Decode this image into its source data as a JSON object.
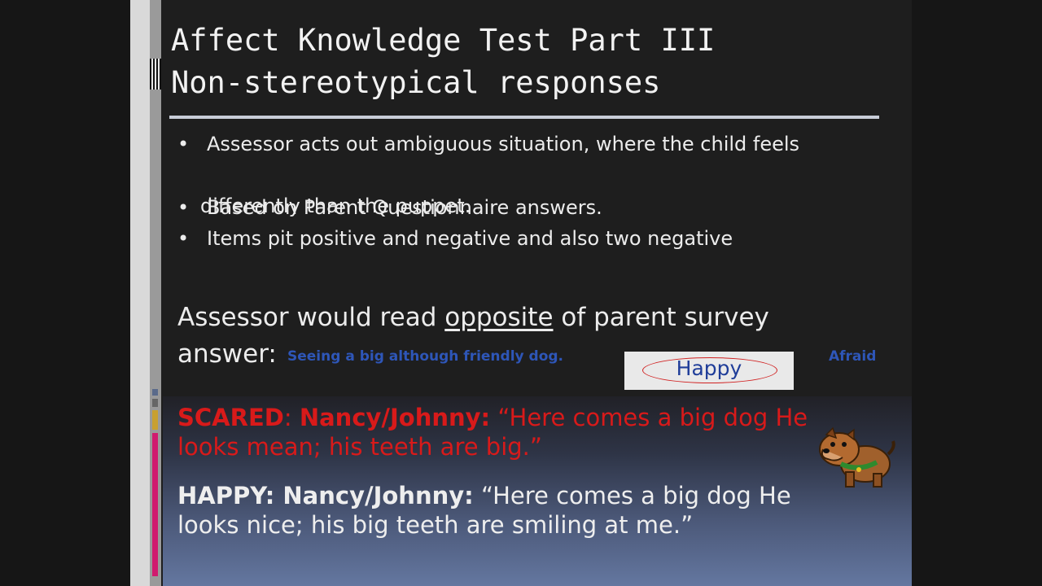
{
  "title": {
    "line1": "Affect Knowledge Test Part III",
    "line2": "Non-stereotypical responses"
  },
  "bullets": {
    "b1_line1": "Assessor acts out ambiguous situation, where the child feels",
    "b1_line2": "differently than the puppet.",
    "b2": "Based on Parent Questionnaire answers.",
    "b3": "Items pit positive and negative and also two negative",
    "marker": "•"
  },
  "assessor": {
    "pre": "Assessor would read ",
    "underlined": "opposite",
    "post": " of parent survey",
    "line2": "answer:",
    "example": "Seeing a big although friendly dog.",
    "selected": "Happy",
    "alternative": "Afraid"
  },
  "scared": {
    "label": "SCARED",
    "sep": ": ",
    "names": "Nancy/Johnny:",
    "quote": " “Here comes a big dog He looks mean; his teeth are big.”"
  },
  "happy": {
    "label": "HAPPY:",
    "names": " Nancy/Johnny:",
    "quote": " “Here comes a big dog He looks nice; his big teeth are smiling at me.”"
  },
  "icons": {
    "dog": "bulldog-clipart-icon"
  },
  "colors": {
    "scared_text": "#d81a1a",
    "answer_blue": "#2e56b8",
    "oval_red": "#d12020"
  }
}
